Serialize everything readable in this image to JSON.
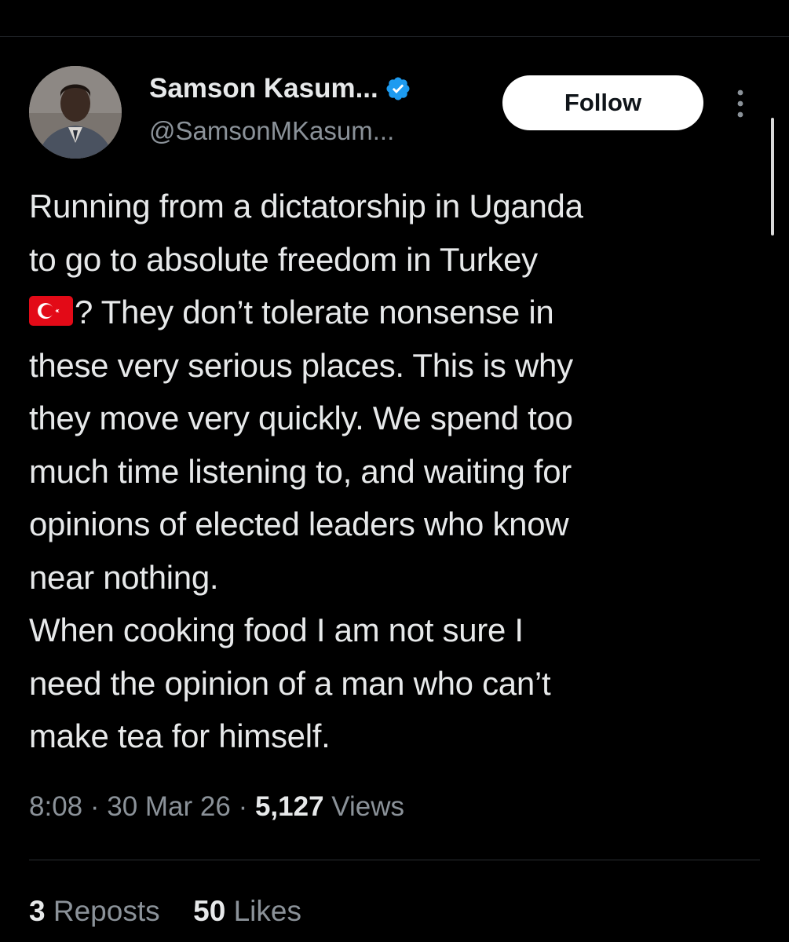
{
  "author": {
    "display_name": "Samson Kasum...",
    "handle": "@SamsonMKasum...",
    "verified": true,
    "verified_color": "#1d9bf0"
  },
  "actions": {
    "follow_label": "Follow",
    "more_icon": "more-vertical-icon"
  },
  "tweet": {
    "lines": [
      "Running from a dictatorship in Uganda",
      "to go to absolute freedom in Turkey",
      "? They don’t tolerate nonsense in",
      "these very serious places. This is why",
      "they move very quickly. We spend too",
      "much time listening to, and waiting for",
      "opinions of elected leaders who know",
      "near nothing.",
      "When cooking food I am not sure I",
      "need the opinion of a man who can’t",
      "make tea for himself."
    ],
    "flag_icon": "turkey-flag-icon"
  },
  "meta": {
    "time": "8:08",
    "date": "30 Mar 26",
    "views_count": "5,127",
    "views_label": "Views",
    "separator": "·"
  },
  "stats": {
    "reposts_count": "3",
    "reposts_label": "Reposts",
    "likes_count": "50",
    "likes_label": "Likes"
  }
}
